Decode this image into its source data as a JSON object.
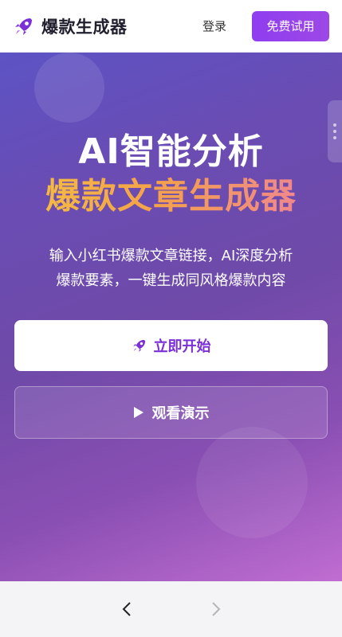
{
  "header": {
    "logo_icon": "rocket-icon",
    "app_name": "爆款生成器",
    "login_label": "登录",
    "trial_label": "免费试用"
  },
  "hero": {
    "title_line1": "AI智能分析",
    "title_line2": "爆款文章生成器",
    "subtitle_line1": "输入小红书爆款文章链接，AI深度分析",
    "subtitle_line2": "爆款要素，一键生成同风格爆款内容",
    "start_button": {
      "icon": "rocket-icon",
      "label": "立即开始"
    },
    "demo_button": {
      "icon": "play-icon",
      "label": "观看演示"
    }
  },
  "bottom_nav": {
    "back_icon": "chevron-left-icon",
    "forward_icon": "chevron-right-icon"
  },
  "colors": {
    "brand_purple": "#8e3df0",
    "title_gradient_start": "#f5c33f",
    "title_gradient_end": "#ee7fa0"
  }
}
